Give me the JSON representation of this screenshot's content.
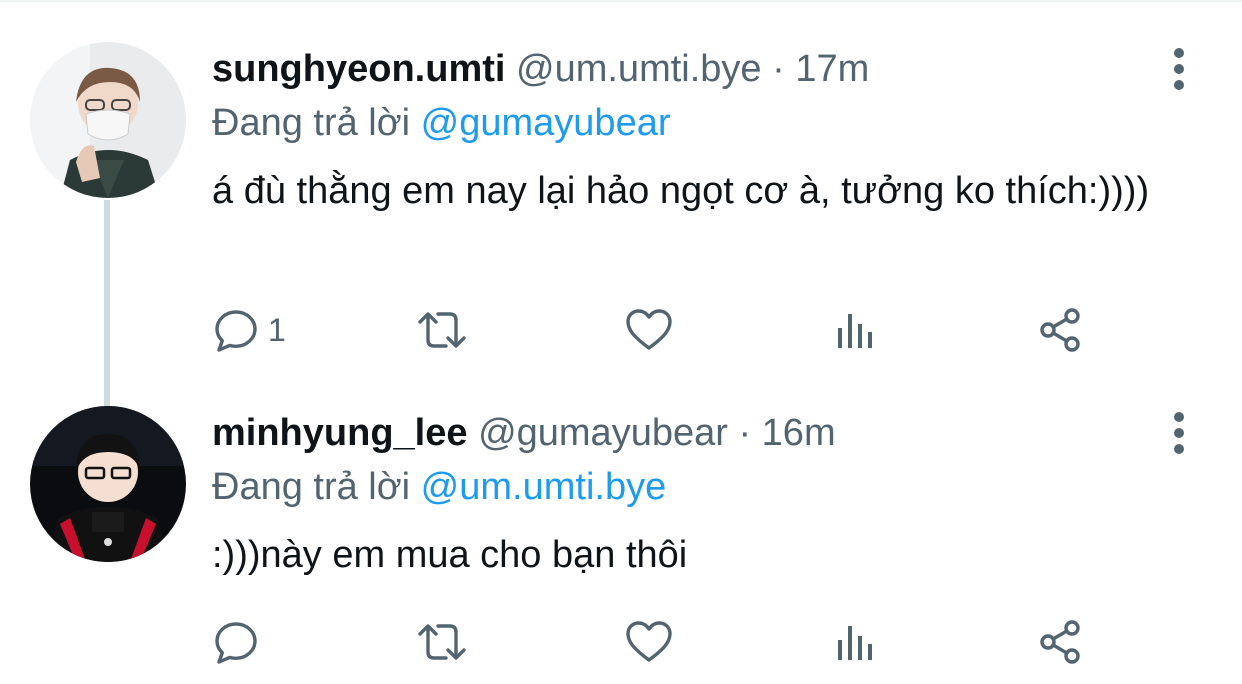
{
  "colors": {
    "primary_text": "#0f1419",
    "secondary_text": "#536471",
    "accent": "#1d9bf0",
    "thread_line": "#cfd9de"
  },
  "tweets": [
    {
      "display_name": "sunghyeon.umti",
      "handle": "@um.umti.bye",
      "separator": "·",
      "time": "17m",
      "reply_prefix": "Đang trả lời",
      "reply_mention": "@gumayubear",
      "text": "á đù thằng em nay lại hảo ngọt cơ à, tưởng ko thích:))))",
      "reply_count": "1",
      "icons": [
        "reply-icon",
        "retweet-icon",
        "like-icon",
        "views-icon",
        "share-icon",
        "more-icon"
      ]
    },
    {
      "display_name": "minhyung_lee",
      "handle": "@gumayubear",
      "separator": "·",
      "time": "16m",
      "reply_prefix": "Đang trả lời",
      "reply_mention": "@um.umti.bye",
      "text": ":)))này em mua cho bạn thôi",
      "reply_count": "",
      "icons": [
        "reply-icon",
        "retweet-icon",
        "like-icon",
        "views-icon",
        "share-icon",
        "more-icon"
      ]
    }
  ]
}
